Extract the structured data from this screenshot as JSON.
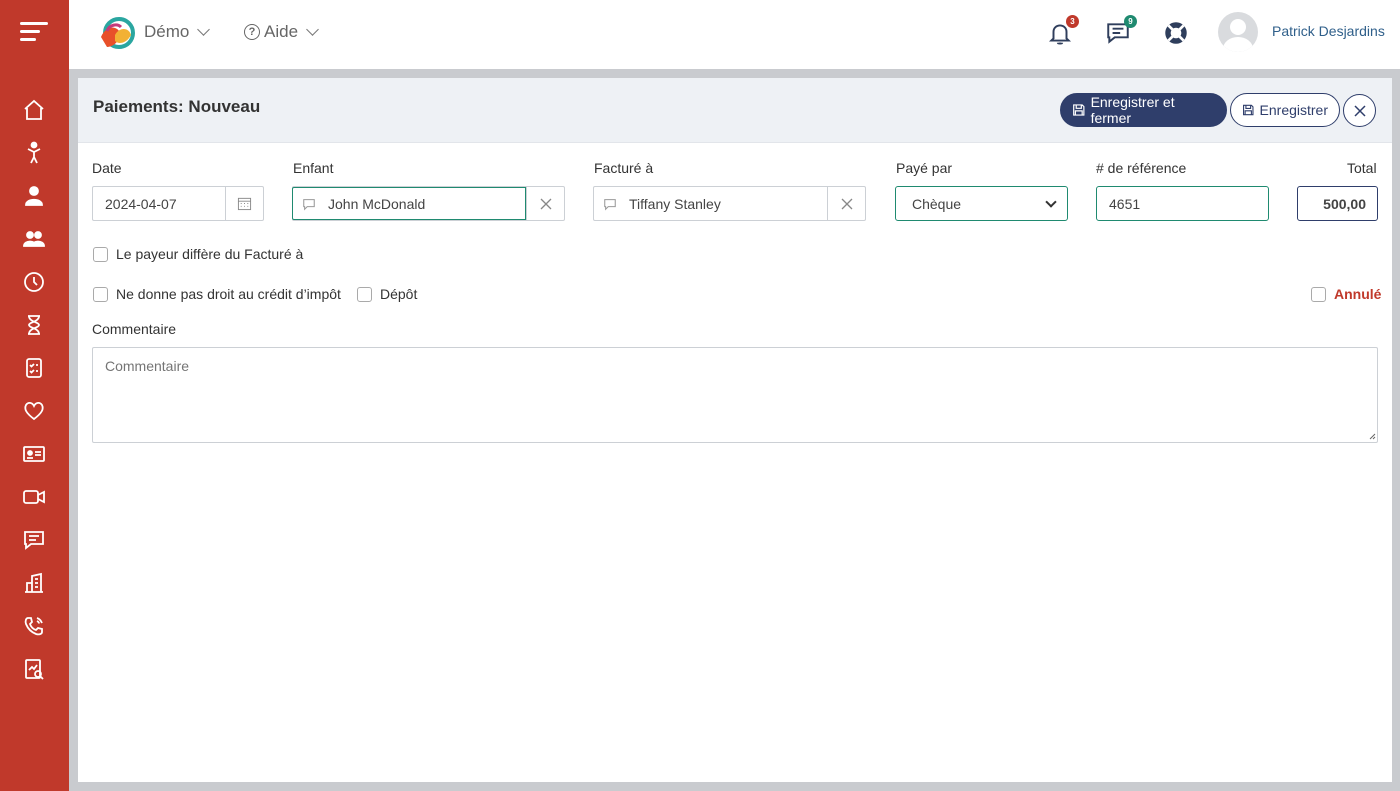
{
  "topbar": {
    "org_label": "Démo",
    "help_label": "Aide",
    "notifications_count": "3",
    "messages_count": "9",
    "user_name": "Patrick Desjardins"
  },
  "sidebar": {
    "items": [
      "home-icon",
      "child-icon",
      "person-icon",
      "group-icon",
      "clock-icon",
      "hourglass-icon",
      "checklist-icon",
      "heart-icon",
      "id-card-icon",
      "video-icon",
      "chat-icon",
      "building-icon",
      "phone-icon",
      "report-icon"
    ]
  },
  "panel": {
    "title": "Paiements: Nouveau",
    "save_close_label": "Enregistrer et fermer",
    "save_label": "Enregistrer"
  },
  "form": {
    "date_label": "Date",
    "date_value": "2024-04-07",
    "child_label": "Enfant",
    "child_value": "John McDonald",
    "billed_label": "Facturé à",
    "billed_value": "Tiffany Stanley",
    "paid_by_label": "Payé par",
    "paid_by_value": "Chèque",
    "reference_label": "# de référence",
    "reference_value": "4651",
    "total_label": "Total",
    "total_value": "500,00",
    "payer_differs_label": "Le payeur diffère du Facturé à",
    "no_tax_credit_label": "Ne donne pas droit au crédit d’impôt",
    "deposit_label": "Dépôt",
    "cancelled_label": "Annulé",
    "comment_label": "Commentaire",
    "comment_placeholder": "Commentaire"
  },
  "colors": {
    "sidebar": "#c0392b",
    "primary": "#2f3e6b",
    "accent_green": "#1f8a70"
  }
}
